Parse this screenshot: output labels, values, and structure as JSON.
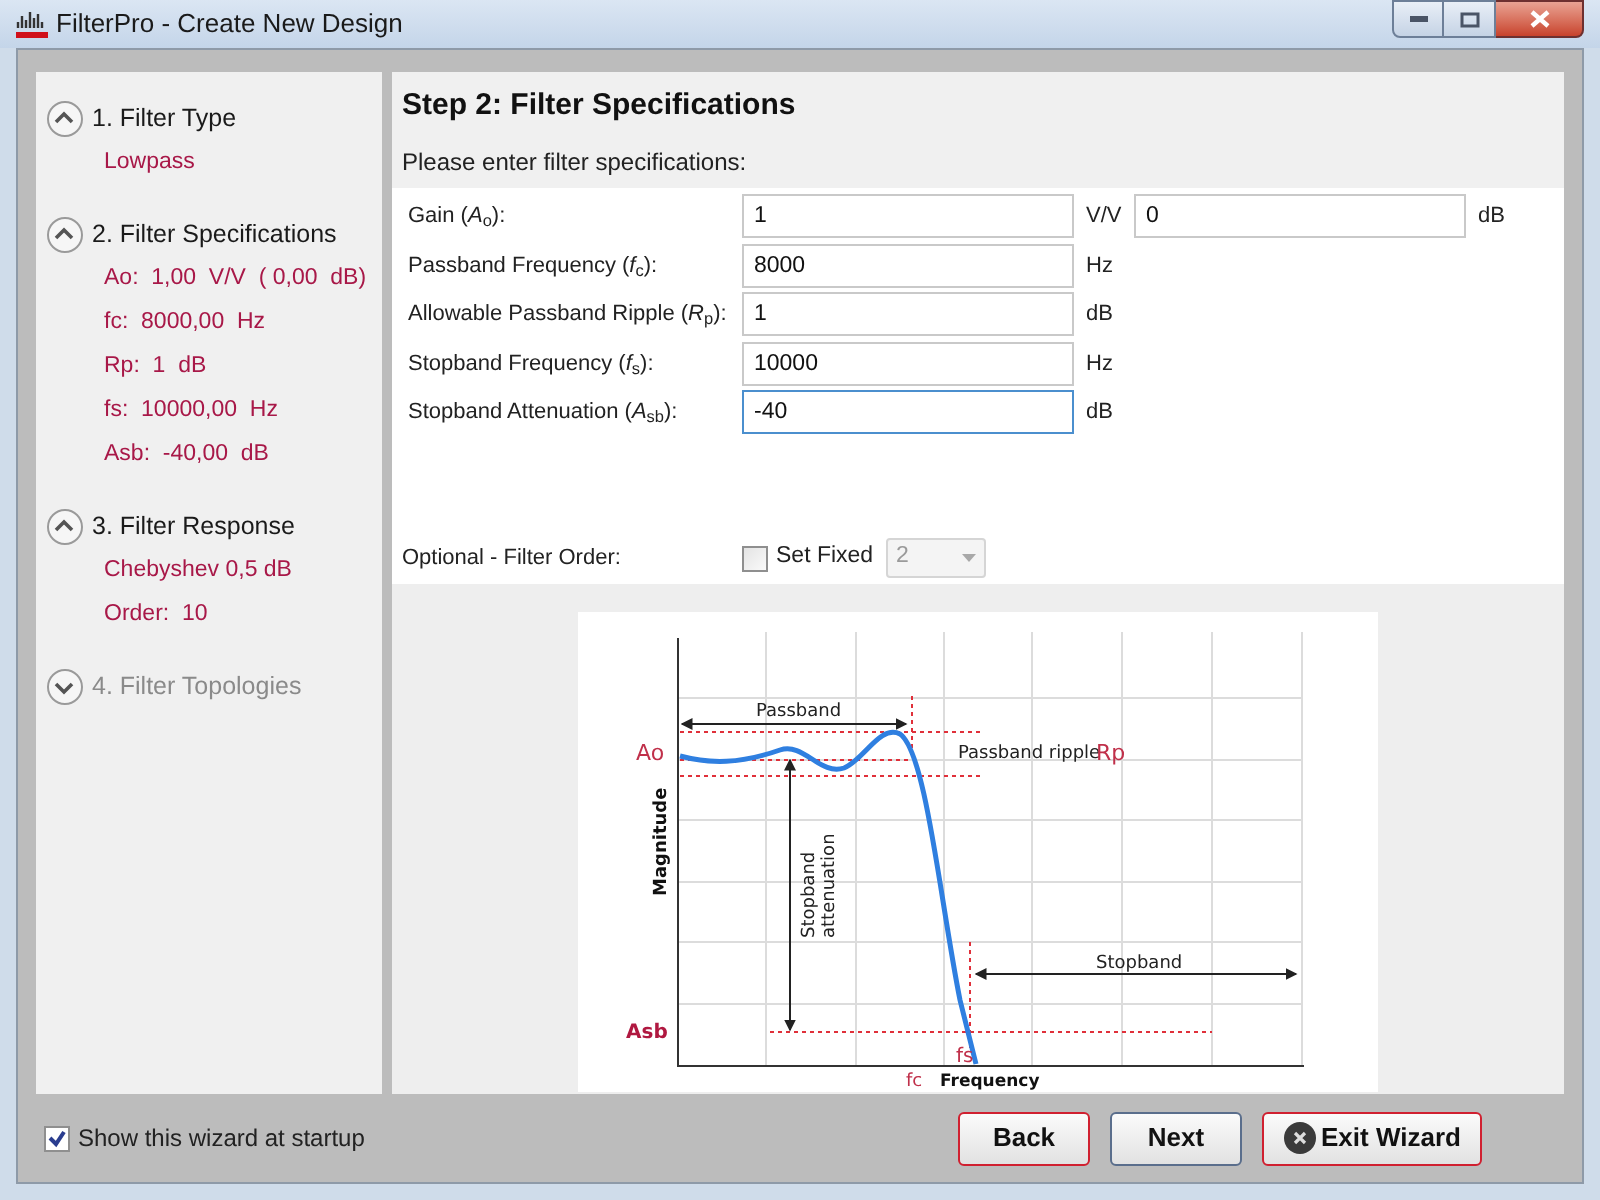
{
  "window": {
    "title": "FilterPro - Create New Design"
  },
  "steps": [
    {
      "label": "1. Filter Type",
      "expanded": true,
      "disabled": false,
      "details": [
        "Lowpass"
      ]
    },
    {
      "label": "2. Filter Specifications",
      "expanded": true,
      "disabled": false,
      "details": [
        "Ao:  1,00  V/V  ( 0,00  dB)",
        "fc:  8000,00  Hz",
        "Rp:  1  dB",
        "fs:  10000,00  Hz",
        "Asb:  -40,00  dB"
      ]
    },
    {
      "label": "3. Filter Response",
      "expanded": true,
      "disabled": false,
      "details": [
        "Chebyshev 0,5 dB",
        "Order:  10"
      ]
    },
    {
      "label": "4. Filter Topologies",
      "expanded": false,
      "disabled": true
    }
  ],
  "step_title": "Step 2: Filter Specifications",
  "prompt": "Please enter filter specifications:",
  "fields": [
    {
      "label": "Gain (*A*$_{o}$):",
      "value": "1",
      "unit": "V/V",
      "focused": false,
      "extra": {
        "value": "0",
        "unit": "dB"
      }
    },
    {
      "label": "Passband Frequency (*f*$_{c}$):",
      "value": "8000",
      "unit": "Hz",
      "focused": false
    },
    {
      "label": "Allowable Passband Ripple (*R*$_{p}$):",
      "value": "1",
      "unit": "dB",
      "focused": false
    },
    {
      "label": "Stopband Frequency (*f*$_{s}$):",
      "value": "10000",
      "unit": "Hz",
      "focused": false
    },
    {
      "label": "Stopband Attenuation (*A*$_{sb}$):",
      "value": "-40",
      "unit": "dB",
      "focused": true
    }
  ],
  "filter_order": {
    "label": "Optional - Filter Order:",
    "checkbox": {
      "label": "Set Fixed",
      "checked": false
    },
    "dropdown": {
      "value": "2",
      "disabled": true
    }
  },
  "diagram": {
    "passband": "Passband",
    "ripple": "Passband ripple",
    "rp": "Rp",
    "ao": "Ao",
    "asb": "Asb",
    "ylabel": "Magnitude",
    "attenuation": [
      "Stopband",
      "attenuation"
    ],
    "stopband": "Stopband",
    "fs": "fs",
    "fc": "fc",
    "xlabel": "Frequency"
  },
  "footer": {
    "startup": {
      "label": "Show this wizard at startup",
      "checked": true
    },
    "buttons": [
      {
        "label": "Back",
        "kind": "normal"
      },
      {
        "label": "Next",
        "kind": "default"
      },
      {
        "label": "Exit Wizard",
        "kind": "close"
      }
    ]
  }
}
